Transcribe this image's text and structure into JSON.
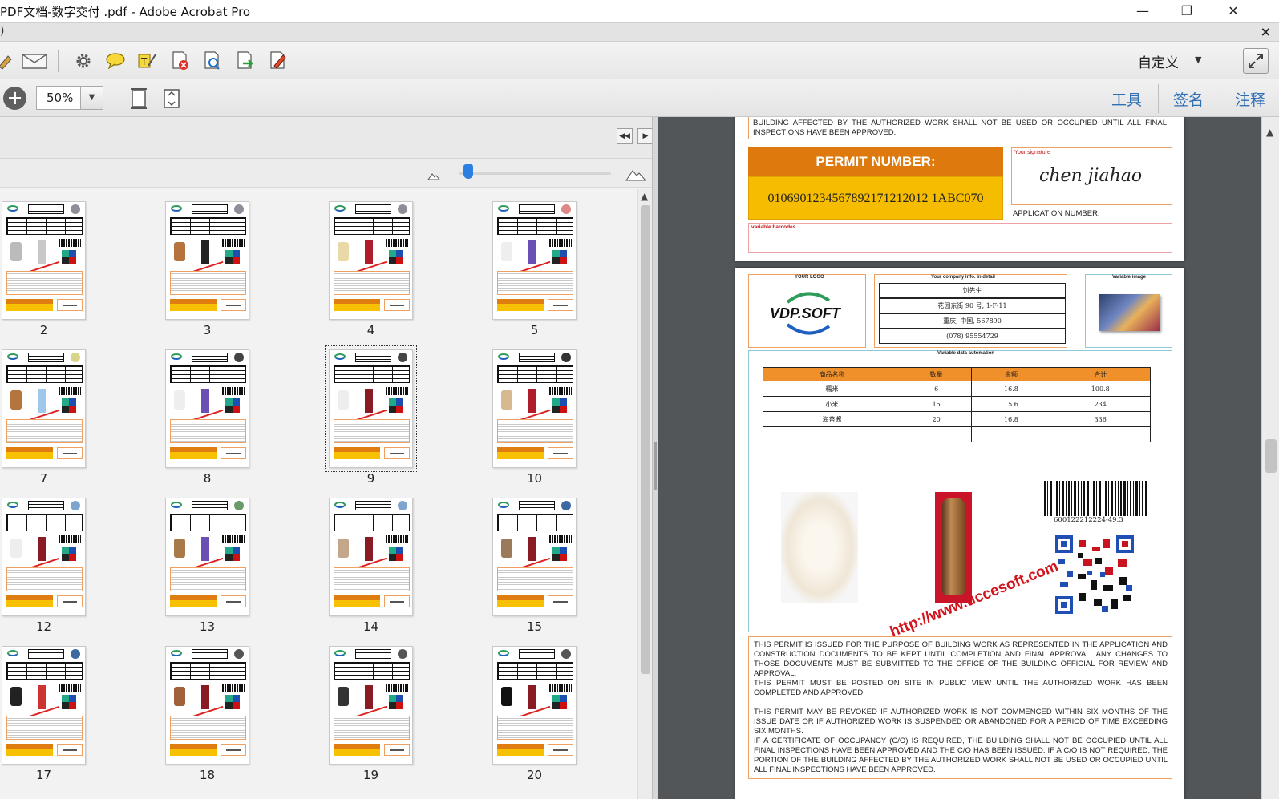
{
  "window": {
    "title": "PDF文档-数字交付 .pdf - Adobe Acrobat Pro",
    "minimize_glyph": "—",
    "restore_glyph": "❐",
    "close_glyph": "✕"
  },
  "menu": {
    "partial_text": ")",
    "close_glyph": "×"
  },
  "toolbar": {
    "icons": [
      "edit-icon",
      "email-icon",
      "settings-icon",
      "comment-icon",
      "highlight-text-icon",
      "delete-page-icon",
      "search-document-icon",
      "export-icon",
      "sign-pen-icon"
    ],
    "customize_label": "自定义",
    "customize_caret": "▼"
  },
  "toolbar2": {
    "zoom_value": "50%",
    "zoom_caret": "▼",
    "panels": [
      "工具",
      "签名",
      "注释"
    ]
  },
  "thumbnails": {
    "rows": [
      {
        "labels": [
          "2",
          "3",
          "4",
          "5"
        ]
      },
      {
        "labels": [
          "7",
          "8",
          "9",
          "10"
        ]
      },
      {
        "labels": [
          "12",
          "13",
          "14",
          "15"
        ]
      },
      {
        "labels": [
          "17",
          "18",
          "19",
          "20"
        ]
      }
    ],
    "selected_page": "9",
    "nav_first": "◀◀",
    "nav_next": "▶"
  },
  "document": {
    "top_continuation": "BUILDING AFFECTED BY THE AUTHORIZED WORK SHALL NOT BE USED OR OCCUPIED UNTIL ALL FINAL INSPECTIONS HAVE BEEN APPROVED.",
    "permit_title": "PERMIT NUMBER:",
    "permit_number": "0106901234567892171212012 1ABC070",
    "signature_label": "Your signature",
    "signature_text": "chen jiahao",
    "application_number_label": "APPLICATION NUMBER:",
    "variable_barcodes_label": "variable barcodes",
    "logo_label": "YOUR LOGO",
    "logo_text": "VDP.SOFT",
    "company_label": "Your company info. in detail",
    "company_rows": [
      "刘先生",
      "花园东街 90 号, 1-F-11",
      "重庆, 中国, 567890",
      "(078) 95554729"
    ],
    "variable_image_label": "Variable image",
    "data_label": "Variable data automation",
    "table": {
      "headers": [
        "商品名称",
        "数量",
        "金额",
        "合计"
      ],
      "rows": [
        [
          "糯米",
          "6",
          "16.8",
          "100.8"
        ],
        [
          "小米",
          "15",
          "15.6",
          "234"
        ],
        [
          "海苔酱",
          "20",
          "16.8",
          "336"
        ],
        [
          "",
          "",
          "",
          ""
        ]
      ]
    },
    "barcode_number": "600122212224-49.3",
    "watermark": "http://www.uccesoft.com",
    "terms": [
      "THIS PERMIT IS ISSUED FOR THE PURPOSE OF BUILDING WORK AS REPRESENTED IN THE APPLICATION AND CONSTRUCTION DOCUMENTS TO BE KEPT UNTIL COMPLETION AND FINAL APPROVAL. ANY CHANGES TO THOSE DOCUMENTS MUST BE SUBMITTED TO THE OFFICE OF THE BUILDING OFFICIAL FOR REVIEW AND APPROVAL.",
      "THIS PERMIT MUST BE POSTED ON SITE IN PUBLIC VIEW UNTIL THE AUTHORIZED WORK HAS BEEN COMPLETED AND APPROVED.",
      "THIS PERMIT MAY BE REVOKED IF AUTHORIZED WORK IS NOT COMMENCED WITHIN SIX MONTHS OF THE ISSUE DATE OR IF AUTHORIZED WORK IS SUSPENDED OR ABANDONED FOR A PERIOD OF TIME EXCEEDING SIX MONTHS.",
      "IF A CERTIFICATE OF OCCUPANCY (C/O) IS REQUIRED, THE BUILDING SHALL NOT BE OCCUPIED UNTIL ALL FINAL INSPECTIONS HAVE BEEN APPROVED AND THE C/O HAS BEEN ISSUED. IF A C/O IS NOT REQUIRED, THE PORTION OF THE BUILDING AFFECTED BY THE AUTHORIZED WORK SHALL NOT BE USED OR OCCUPIED UNTIL ALL FINAL INSPECTIONS HAVE BEEN APPROVED."
    ]
  },
  "colors": {
    "accent_blue": "#2f6fb5",
    "permit_orange": "#de7a0d",
    "permit_yellow": "#f6bd00",
    "doc_background": "#525659"
  }
}
